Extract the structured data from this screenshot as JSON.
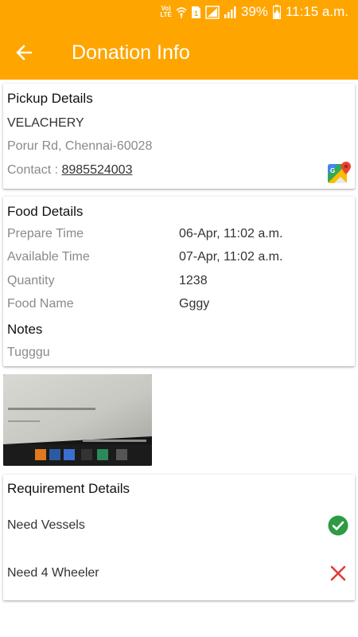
{
  "status_bar": {
    "volte": "VoLTE",
    "battery": "39%",
    "time": "11:15 a.m."
  },
  "toolbar": {
    "title": "Donation Info"
  },
  "pickup": {
    "heading": "Pickup Details",
    "name": "VELACHERY",
    "address": "Porur Rd, Chennai-60028",
    "contact_label": "Contact : ",
    "phone": "8985524003"
  },
  "food": {
    "heading": "Food Details",
    "rows": [
      {
        "label": "Prepare Time",
        "value": "06-Apr, 11:02 a.m."
      },
      {
        "label": "Available Time",
        "value": "07-Apr, 11:02 a.m."
      },
      {
        "label": "Quantity",
        "value": "1238"
      },
      {
        "label": "Food Name",
        "value": "Gggy"
      }
    ],
    "notes_heading": "Notes",
    "notes": "Tugggu"
  },
  "requirements": {
    "heading": "Requirement Details",
    "items": [
      {
        "label": "Need Vessels",
        "status": "yes",
        "icon": "check-circle-icon",
        "color": "#2E9B45"
      },
      {
        "label": "Need 4 Wheeler",
        "status": "no",
        "icon": "cross-icon",
        "color": "#E53935"
      }
    ]
  },
  "colors": {
    "accent": "#FFA500"
  }
}
